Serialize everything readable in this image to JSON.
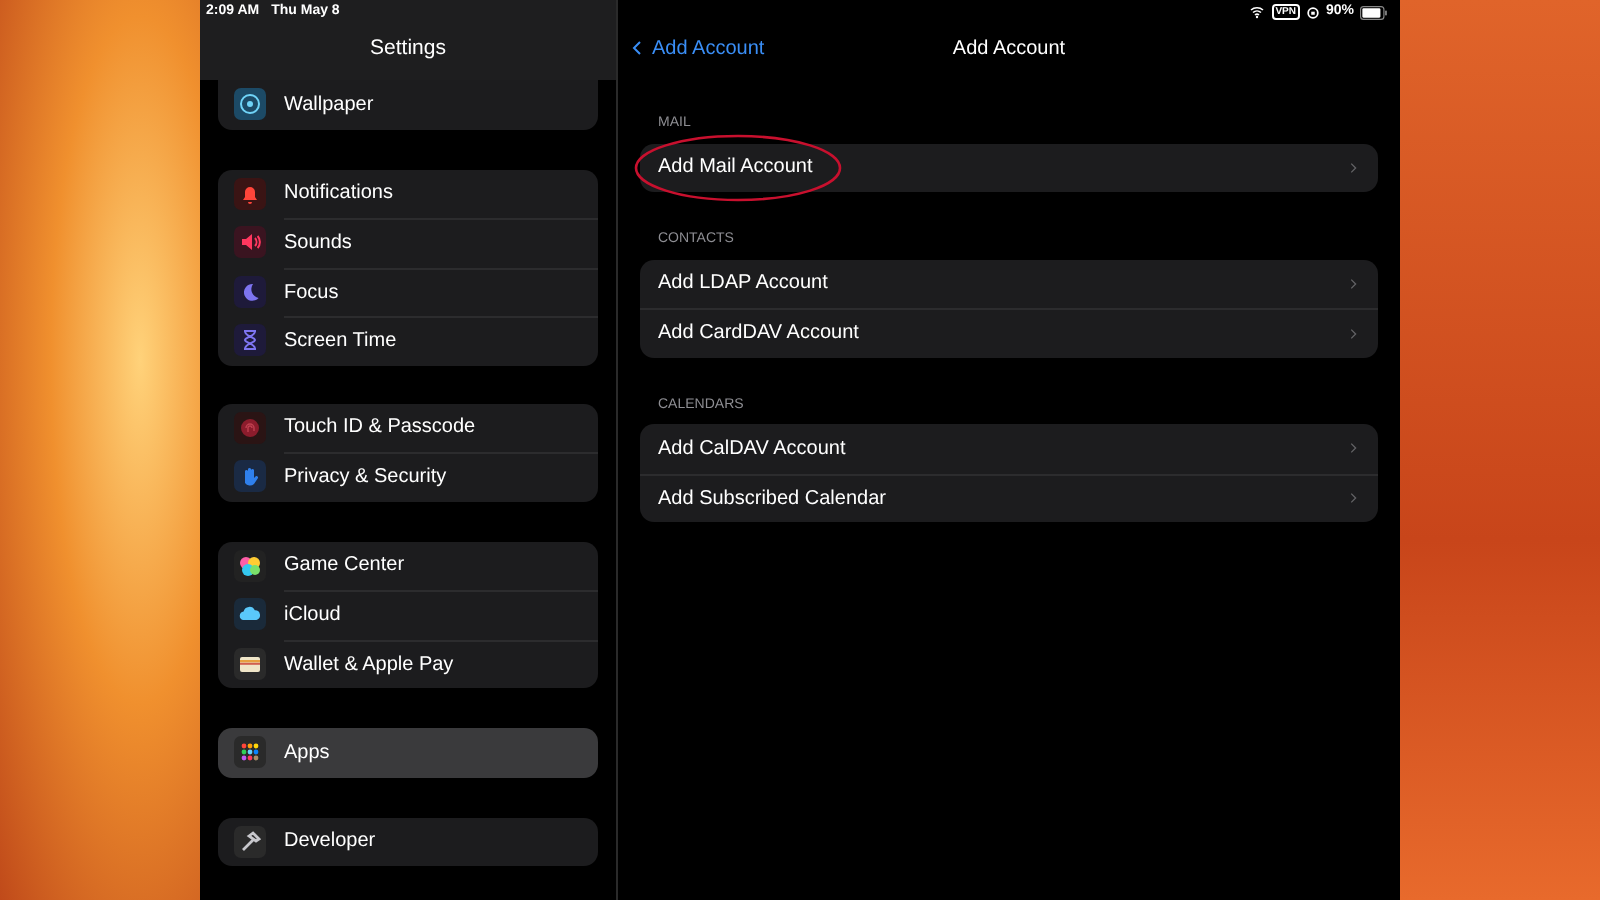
{
  "status_bar": {
    "time": "2:09 AM",
    "date": "Thu May 8",
    "vpn": "VPN",
    "battery": "90%"
  },
  "sidebar": {
    "title": "Settings",
    "groups": [
      {
        "items": [
          {
            "label": "Wallpaper",
            "selected": false
          }
        ]
      },
      {
        "items": [
          {
            "label": "Notifications",
            "selected": false
          },
          {
            "label": "Sounds",
            "selected": false
          },
          {
            "label": "Focus",
            "selected": false
          },
          {
            "label": "Screen Time",
            "selected": false
          }
        ]
      },
      {
        "items": [
          {
            "label": "Touch ID & Passcode",
            "selected": false
          },
          {
            "label": "Privacy & Security",
            "selected": false
          }
        ]
      },
      {
        "items": [
          {
            "label": "Game Center",
            "selected": false
          },
          {
            "label": "iCloud",
            "selected": false
          },
          {
            "label": "Wallet & Apple Pay",
            "selected": false
          }
        ]
      },
      {
        "items": [
          {
            "label": "Apps",
            "selected": true
          }
        ]
      },
      {
        "items": [
          {
            "label": "Developer",
            "selected": false
          }
        ]
      }
    ]
  },
  "detail": {
    "back": "Add Account",
    "title": "Add Account",
    "sections": [
      {
        "header": "MAIL",
        "items": [
          {
            "label": "Add Mail Account",
            "circled": true
          }
        ]
      },
      {
        "header": "CONTACTS",
        "items": [
          {
            "label": "Add LDAP Account",
            "circled": false
          },
          {
            "label": "Add CardDAV Account",
            "circled": false
          }
        ]
      },
      {
        "header": "CALENDARS",
        "items": [
          {
            "label": "Add CalDAV Account",
            "circled": false
          },
          {
            "label": "Add Subscribed Calendar",
            "circled": false
          }
        ]
      }
    ]
  }
}
